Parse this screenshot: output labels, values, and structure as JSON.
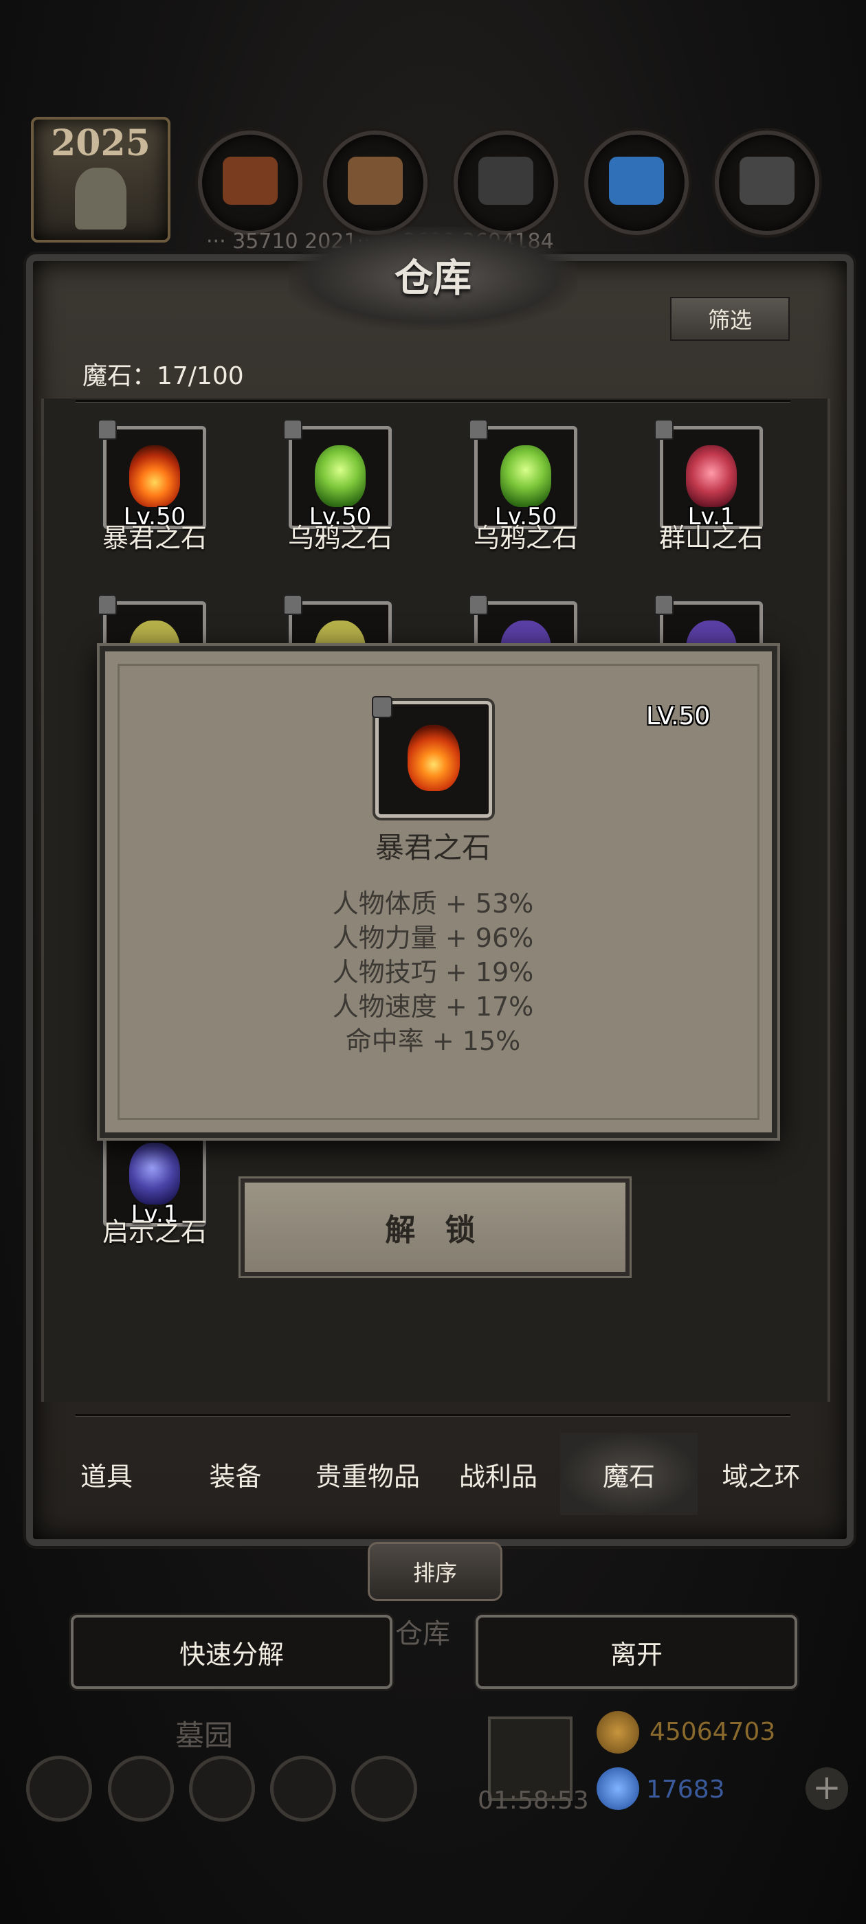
{
  "top_bar": {
    "year_badge": "2025",
    "resources_text": "··· 35710   2021··· ···3699 3694184"
  },
  "warehouse": {
    "title": "仓库",
    "filter_label": "筛选",
    "stone_count_label": "魔石：17/100",
    "items": [
      {
        "name": "暴君之石",
        "level": "Lv.50",
        "gem_color": "#e8551a"
      },
      {
        "name": "乌鸦之石",
        "level": "Lv.50",
        "gem_color": "#7cc73a"
      },
      {
        "name": "乌鸦之石",
        "level": "Lv.50",
        "gem_color": "#7cc73a"
      },
      {
        "name": "群山之石",
        "level": "Lv.1",
        "gem_color": "#c2394d"
      }
    ],
    "second_row_gem_colors": [
      "#b8b24a",
      "#b8b24a",
      "#5b3fa6",
      "#5b3fa6"
    ],
    "bottom_item": {
      "name": "启示之石",
      "level": "Lv.1",
      "gem_color": "#4a44a8"
    }
  },
  "popup": {
    "level": "LV.50",
    "name": "暴君之石",
    "stats": [
      "人物体质 + 53%",
      "人物力量 + 96%",
      "人物技巧 + 19%",
      "人物速度 + 17%",
      "命中率 + 15%"
    ],
    "unlock_label": "解 锁"
  },
  "tabs": [
    {
      "label": "道具",
      "active": false
    },
    {
      "label": "装备",
      "active": false
    },
    {
      "label": "贵重物品",
      "active": false
    },
    {
      "label": "战利品",
      "active": false
    },
    {
      "label": "魔石",
      "active": true
    },
    {
      "label": "域之环",
      "active": false
    }
  ],
  "sort_label": "排序",
  "actions": {
    "quick_decompose": "快速分解",
    "leave": "离开",
    "background_label": "仓库"
  },
  "bottom_hud": {
    "area_label": "墓园",
    "timer": "01:58:53",
    "gold": "45064703",
    "gems": "17683"
  },
  "colors": {
    "gold_text": "#8a6a2c",
    "gem_text": "#3a5a9c"
  }
}
